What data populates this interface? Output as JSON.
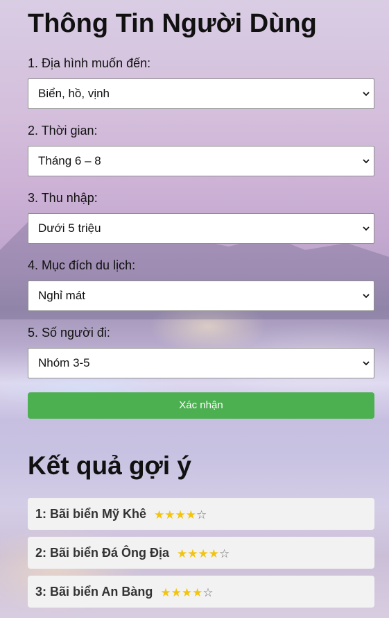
{
  "form": {
    "title": "Thông Tin Người Dùng",
    "questions": [
      {
        "label": "1. Địa hình muốn đến:",
        "selected": "Biển, hồ, vịnh"
      },
      {
        "label": "2. Thời gian:",
        "selected": "Tháng 6 – 8"
      },
      {
        "label": "3. Thu nhập:",
        "selected": "Dưới 5 triệu"
      },
      {
        "label": "4. Mục đích du lịch:",
        "selected": "Nghỉ mát"
      },
      {
        "label": "5. Số người đi:",
        "selected": "Nhóm 3-5"
      }
    ],
    "submit_label": "Xác nhận"
  },
  "results": {
    "title": "Kết quả gợi ý",
    "items": [
      {
        "text": "1: Bãi biển Mỹ Khê",
        "rating": 4,
        "max_rating": 5
      },
      {
        "text": "2: Bãi biển Đá Ông Địa",
        "rating": 4,
        "max_rating": 5
      },
      {
        "text": "3: Bãi biển An Bàng",
        "rating": 4,
        "max_rating": 5
      }
    ]
  },
  "colors": {
    "submit_bg": "#4caf50",
    "star_filled": "#f2c40f",
    "star_empty": "#777777",
    "result_bg": "#f2f2f2"
  },
  "icons": {
    "select_arrow": "chevron-down-icon",
    "star_filled": "star-filled-icon",
    "star_empty": "star-outline-icon"
  }
}
